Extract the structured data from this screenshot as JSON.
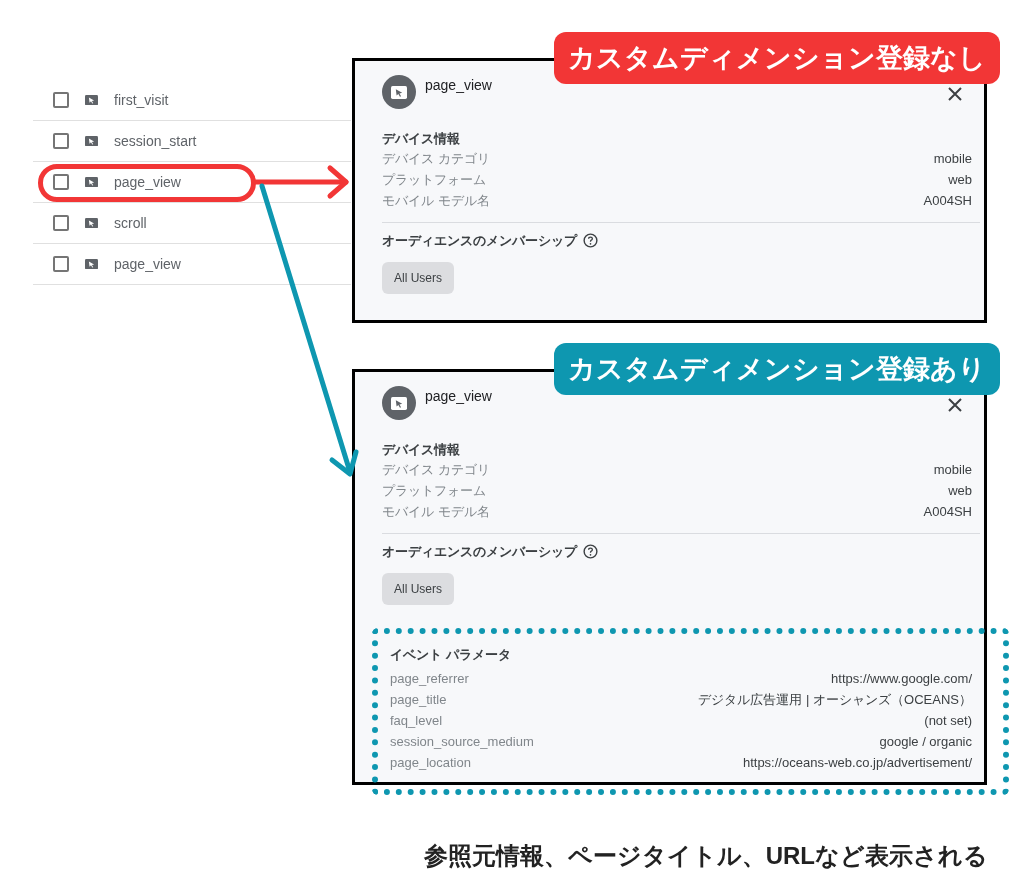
{
  "events": [
    {
      "name": "first_visit",
      "checked": false,
      "highlighted": false
    },
    {
      "name": "session_start",
      "checked": false,
      "highlighted": false
    },
    {
      "name": "page_view",
      "checked": false,
      "highlighted": true
    },
    {
      "name": "scroll",
      "checked": false,
      "highlighted": false
    },
    {
      "name": "page_view",
      "checked": false,
      "highlighted": false
    }
  ],
  "panels": [
    {
      "label": "カスタムディメンション登録なし",
      "color": "#f23636",
      "title": "page_view",
      "device_heading": "デバイス情報",
      "device_rows": [
        {
          "name": "デバイス カテゴリ",
          "value": "mobile"
        },
        {
          "name": "プラットフォーム",
          "value": "web"
        },
        {
          "name": "モバイル モデル名",
          "value": "A004SH"
        }
      ],
      "audience_heading": "オーディエンスのメンバーシップ",
      "audience_chips": [
        "All Users"
      ]
    },
    {
      "label": "カスタムディメンション登録あり",
      "color": "#0e97b0",
      "title": "page_view",
      "device_heading": "デバイス情報",
      "device_rows": [
        {
          "name": "デバイス カテゴリ",
          "value": "mobile"
        },
        {
          "name": "プラットフォーム",
          "value": "web"
        },
        {
          "name": "モバイル モデル名",
          "value": "A004SH"
        }
      ],
      "audience_heading": "オーディエンスのメンバーシップ",
      "audience_chips": [
        "All Users"
      ],
      "params": {
        "heading": "イベント パラメータ",
        "rows": [
          {
            "name": "page_referrer",
            "value": "https://www.google.com/"
          },
          {
            "name": "page_title",
            "value": "デジタル広告運用 | オーシャンズ（OCEANS）"
          },
          {
            "name": "faq_level",
            "value": "(not set)"
          },
          {
            "name": "session_source_medium",
            "value": "google / organic"
          },
          {
            "name": "page_location",
            "value": "https://oceans-web.co.jp/advertisement/"
          }
        ]
      }
    }
  ],
  "caption": "参照元情報、ページタイトル、URLなど表示される"
}
